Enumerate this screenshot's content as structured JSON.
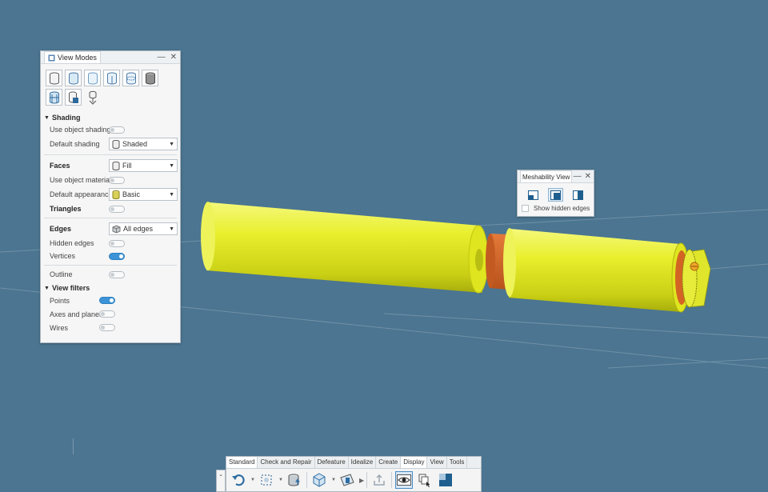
{
  "colors": {
    "background": "#4b7591",
    "part_yellow": "#e8ee2a",
    "part_orange": "#d96a2c",
    "toggle_on": "#3d93d6"
  },
  "view_modes": {
    "title": "View Modes",
    "mode_icons": [
      "shaded-icon",
      "shaded-edges-icon",
      "transparent-icon",
      "hidden-line-icon",
      "wireframe-edges-icon",
      "dark-shaded-icon",
      "mesh-icon",
      "surface-mesh-icon",
      "clip-icon"
    ],
    "shading": {
      "header": "Shading",
      "use_object_shading": "Use object shading",
      "default_shading_label": "Default shading",
      "default_shading_value": "Shaded"
    },
    "faces": {
      "label": "Faces",
      "value": "Fill",
      "use_object_material": "Use object material",
      "default_appearance_label": "Default appearance",
      "default_appearance_value": "Basic",
      "triangles": "Triangles"
    },
    "edges": {
      "label": "Edges",
      "value": "All edges",
      "hidden_edges": "Hidden edges",
      "vertices": "Vertices",
      "outline": "Outline"
    },
    "view_filters": {
      "header": "View filters",
      "points": "Points",
      "axes_and_planes": "Axes and planes",
      "wires": "Wires"
    }
  },
  "meshability": {
    "title": "Meshability View",
    "show_hidden_edges": "Show hidden edges"
  },
  "toolbar": {
    "tabs": [
      "Standard",
      "Check and Repair",
      "Defeature",
      "Idealize",
      "Create",
      "Display",
      "View",
      "Tools"
    ]
  }
}
